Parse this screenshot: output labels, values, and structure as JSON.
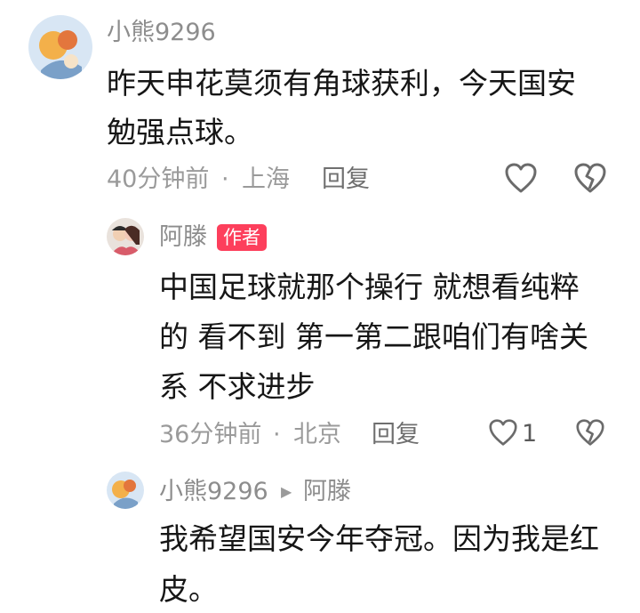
{
  "comments": [
    {
      "username": "小熊9296",
      "lines": [
        "昨天申花莫须有角球获利，今天国安",
        "勉强点球。"
      ],
      "time": "40分钟前",
      "separator": "·",
      "location": "上海",
      "reply_label": "回复"
    },
    {
      "username": "阿滕",
      "author_badge": "作者",
      "lines": [
        "中国足球就那个操行 就想看纯粹",
        "的 看不到 第一第二跟咱们有啥关",
        "系 不求进步"
      ],
      "time": "36分钟前",
      "separator": "·",
      "location": "北京",
      "reply_label": "回复",
      "like_count": "1"
    },
    {
      "username": "小熊9296",
      "reply_to": "阿滕",
      "lines": [
        "我希望国安今年夺冠。因为我是红",
        "皮。"
      ]
    }
  ],
  "icons": {
    "like": "heart-outline-icon",
    "dislike": "broken-heart-icon",
    "reply_arrow": "play-triangle-icon"
  },
  "colors": {
    "badge_bg": "#fd3f5c",
    "username": "#8d8d8d",
    "body": "#161616",
    "meta": "#9a9a9a"
  }
}
